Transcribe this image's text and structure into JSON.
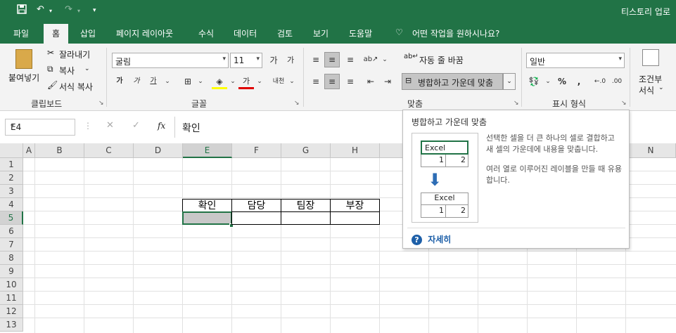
{
  "titlebar": {
    "title": "티스토리 업로",
    "qa_icons": [
      "save-icon",
      "undo-icon",
      "redo-icon",
      "customize-icon"
    ]
  },
  "tabs": [
    "파일",
    "홈",
    "삽입",
    "페이지 레이아웃",
    "수식",
    "데이터",
    "검토",
    "보기",
    "도움말"
  ],
  "active_tab": "홈",
  "tell_me": "어떤 작업을 원하시나요?",
  "ribbon": {
    "clipboard": {
      "paste": "붙여넣기",
      "cut": "잘라내기",
      "copy": "복사",
      "format_painter": "서식 복사",
      "group": "클립보드"
    },
    "font": {
      "name": "굴림",
      "size": "11",
      "group": "글꼴"
    },
    "alignment": {
      "wrap": "자동 줄 바꿈",
      "merge": "병합하고 가운데 맞춤",
      "group": "맞춤"
    },
    "number": {
      "format": "일반",
      "percent": "%",
      "comma": ",",
      "group": "표시 형식"
    },
    "styles": {
      "conditional_line1": "조건부",
      "conditional_line2": "서식"
    }
  },
  "formula_bar": {
    "cell_ref": "E4",
    "fx": "fx",
    "value": "확인"
  },
  "columns": [
    "A",
    "B",
    "C",
    "D",
    "E",
    "F",
    "G",
    "H",
    "N"
  ],
  "rows": [
    "1",
    "2",
    "3",
    "4",
    "5",
    "6",
    "7",
    "8",
    "9",
    "10",
    "11",
    "12",
    "13"
  ],
  "cells": {
    "E4": "확인",
    "F4": "담당",
    "G4": "팀장",
    "H4": "부장"
  },
  "tooltip": {
    "title": "병합하고 가운데 맞춤",
    "illus_label": "Excel",
    "illus_n1": "1",
    "illus_n2": "2",
    "desc1": "선택한 셀을 더 큰 하나의 셀로 결합하고 새 셀의 가운데에 내용을 맞춥니다.",
    "desc2": "여러 열로 이루어진 레이블을 만들 때 유용합니다.",
    "help": "자세히"
  }
}
